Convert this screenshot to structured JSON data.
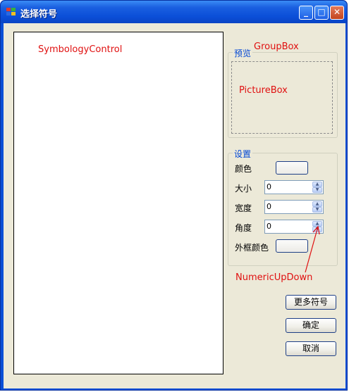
{
  "window": {
    "title": "选择符号",
    "controls": {
      "minimize": "_",
      "maximize": "□",
      "close": "✕"
    }
  },
  "symbology_control": {
    "annotation": "SymbologyControl"
  },
  "preview_group": {
    "title": "预览",
    "annotation": "GroupBox",
    "picturebox_annotation": "PictureBox"
  },
  "settings_group": {
    "title": "设置",
    "color_label": "颜色",
    "size_label": "大小",
    "size_value": "0",
    "width_label": "宽度",
    "width_value": "0",
    "angle_label": "角度",
    "angle_value": "0",
    "outline_color_label": "外框颜色"
  },
  "numeric_annotation": "NumericUpDown",
  "buttons": {
    "more_symbols": "更多符号",
    "ok": "确定",
    "cancel": "取消"
  },
  "colors": {
    "annotation_red": "#e01010",
    "group_title_blue": "#0046d5"
  }
}
